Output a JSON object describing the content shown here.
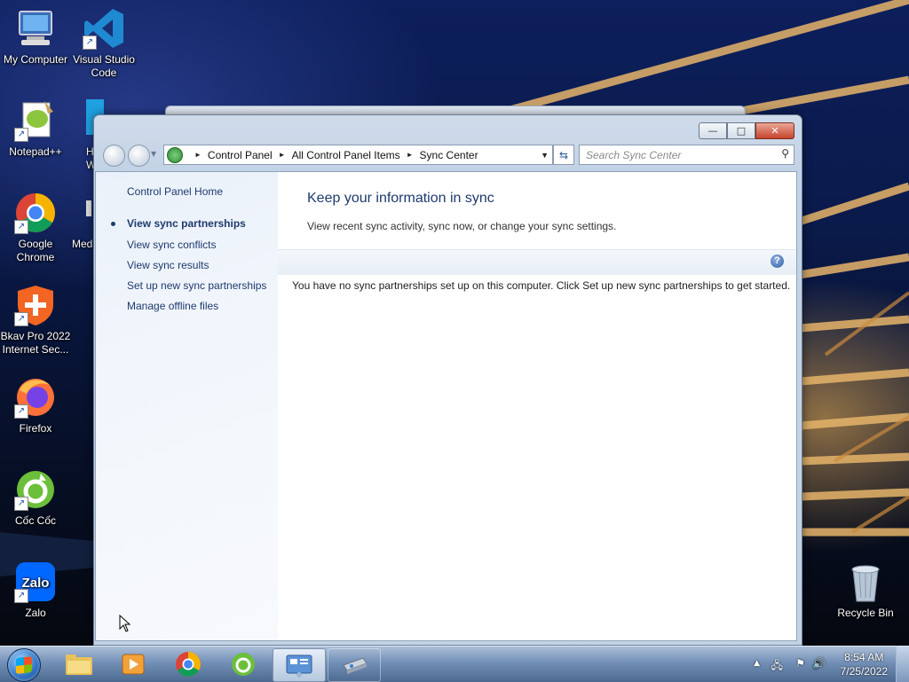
{
  "desktop": {
    "icons": [
      {
        "label": "My Computer",
        "icon": "computer-icon"
      },
      {
        "label": "Visual Studio Code",
        "icon": "vscode-icon"
      },
      {
        "label": "Notepad++",
        "icon": "notepadpp-icon"
      },
      {
        "label": "H Win",
        "icon": "app-icon"
      },
      {
        "label": "Google Chrome",
        "icon": "chrome-icon"
      },
      {
        "label": "Med",
        "icon": "media-icon"
      },
      {
        "label": "Bkav Pro 2022 Internet Sec...",
        "icon": "bkav-icon"
      },
      {
        "label": "Firefox",
        "icon": "firefox-icon"
      },
      {
        "label": "Cốc Cốc",
        "icon": "coccoc-icon"
      },
      {
        "label": "Zalo",
        "icon": "zalo-icon"
      },
      {
        "label": "Recycle Bin",
        "icon": "recycle-bin-icon"
      }
    ]
  },
  "window": {
    "buttons": {
      "minimize": "—",
      "maximize": "□",
      "close": "✕"
    },
    "address": {
      "crumbs": [
        "Control Panel",
        "All Control Panel Items",
        "Sync Center"
      ],
      "separator": "►"
    },
    "search": {
      "placeholder": "Search Sync Center"
    },
    "sidebar": {
      "home": "Control Panel Home",
      "links": [
        {
          "label": "View sync partnerships",
          "current": true
        },
        {
          "label": "View sync conflicts"
        },
        {
          "label": "View sync results"
        },
        {
          "label": "Set up new sync partnerships"
        },
        {
          "label": "Manage offline files"
        }
      ]
    },
    "main": {
      "title": "Keep your information in sync",
      "subtitle": "View recent sync activity, sync now, or change your sync settings.",
      "help": "?",
      "message": "You have no sync partnerships set up on this computer. Click Set up new sync partnerships to get started."
    }
  },
  "taskbar": {
    "items": [
      "windows-explorer",
      "media-player",
      "chrome",
      "coccoc",
      "control-panel",
      "device"
    ],
    "clock": {
      "time": "8:54 AM",
      "date": "7/25/2022"
    }
  }
}
